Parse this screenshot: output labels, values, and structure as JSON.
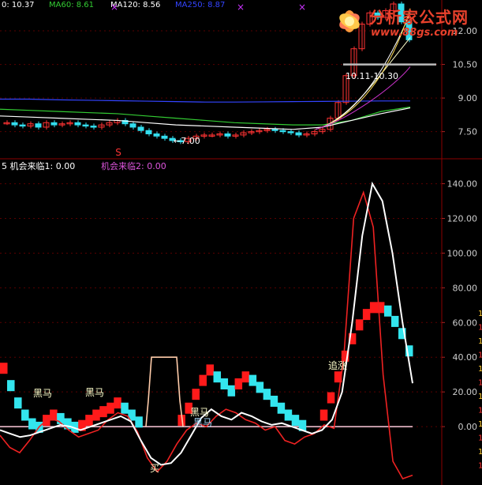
{
  "top_header": {
    "items": [
      {
        "text": "0: 10.37",
        "color": "#ffffff"
      },
      {
        "text": "MA60: 8.61",
        "color": "#33cc33"
      },
      {
        "text": "MA120: 8.56",
        "color": "#ffffff"
      },
      {
        "text": "MA250: 8.87",
        "color": "#3344ff"
      }
    ]
  },
  "bottom_header": {
    "items": [
      {
        "text": "5 机会来临1: 0.00",
        "color": "#ffffff"
      },
      {
        "text": "机会来临2: 0.00",
        "color": "#dd55dd"
      }
    ]
  },
  "watermark": {
    "title": "分析家公式网",
    "url": "www.88gs.com"
  },
  "annotations": {
    "range_label": "10.11-10.30",
    "low_label": "←7.00",
    "sell_marker": "S",
    "black_horse_1": "黑马",
    "black_horse_2": "黑马",
    "black_horse_3": "黑马",
    "black_horse_4": "黑马",
    "chase_label": "追涨",
    "buy_marker": "买"
  },
  "chart_data": [
    {
      "type": "line",
      "title": "",
      "ylim": [
        6.5,
        13.2
      ],
      "y_ticks": [
        "12.00",
        "10.50",
        "9.00",
        "7.50"
      ],
      "candles_close": [
        7.9,
        7.8,
        7.75,
        7.85,
        7.7,
        7.9,
        7.8,
        7.85,
        7.9,
        7.8,
        7.75,
        7.7,
        7.8,
        7.9,
        8.0,
        7.85,
        7.7,
        7.55,
        7.4,
        7.3,
        7.2,
        7.1,
        7.05,
        7.2,
        7.3,
        7.35,
        7.35,
        7.4,
        7.3,
        7.35,
        7.45,
        7.5,
        7.55,
        7.6,
        7.55,
        7.5,
        7.45,
        7.35,
        7.4,
        7.5,
        7.6,
        8.1,
        8.8,
        10.0,
        11.2,
        12.3,
        12.8,
        12.6,
        12.9,
        13.2,
        12.4,
        11.6
      ],
      "series": [
        {
          "name": "MA60",
          "color": "#33cc33",
          "values": [
            8.5,
            8.45,
            8.4,
            8.35,
            8.3,
            8.2,
            8.1,
            8.0,
            7.9,
            7.85,
            7.8,
            7.8,
            8.0,
            8.4,
            8.6
          ]
        },
        {
          "name": "MA120",
          "color": "#ffffff",
          "values": [
            8.2,
            8.15,
            8.1,
            8.05,
            8.0,
            7.9,
            7.8,
            7.75,
            7.7,
            7.65,
            7.6,
            7.7,
            8.0,
            8.3,
            8.56
          ]
        },
        {
          "name": "MA250",
          "color": "#3344ff",
          "values": [
            8.95,
            8.95,
            8.92,
            8.9,
            8.88,
            8.86,
            8.84,
            8.82,
            8.82,
            8.83,
            8.84,
            8.85,
            8.86,
            8.87,
            8.87
          ]
        }
      ],
      "reference_line": 10.5
    },
    {
      "type": "line",
      "title": "",
      "ylim": [
        -30,
        148
      ],
      "y_ticks": [
        "140.00",
        "120.00",
        "100.00",
        "80.00",
        "60.00",
        "40.00",
        "20.00",
        "0.00"
      ],
      "series": [
        {
          "name": "",
          "color": "#ee2222",
          "values": [
            -5,
            -12,
            -15,
            -8,
            0,
            5,
            3,
            -2,
            -6,
            -4,
            -2,
            4,
            8,
            6,
            -3,
            -18,
            -26,
            -20,
            -10,
            -2,
            2,
            0,
            6,
            10,
            8,
            4,
            2,
            -2,
            0,
            -8,
            -10,
            -6,
            -4,
            1,
            -1,
            40,
            120,
            135,
            115,
            30,
            -20,
            -30,
            -28
          ]
        },
        {
          "name": "",
          "color": "#ffffff",
          "values": [
            -2,
            -4,
            -6,
            -5,
            -3,
            -1,
            1,
            0,
            -2,
            0,
            2,
            4,
            6,
            3,
            -8,
            -18,
            -22,
            -21,
            -15,
            -5,
            5,
            10,
            6,
            4,
            8,
            6,
            3,
            1,
            2,
            0,
            -2,
            -4,
            -2,
            4,
            20,
            60,
            110,
            140,
            130,
            100,
            60,
            25
          ]
        },
        {
          "name": "",
          "color": "#ffccaa",
          "values": [
            0,
            0,
            0,
            0,
            0,
            0,
            0,
            0,
            0,
            0,
            0,
            40,
            40,
            40,
            0,
            0,
            0,
            0,
            0,
            0
          ]
        }
      ],
      "bars": [
        35,
        25,
        15,
        8,
        3,
        1,
        5,
        8,
        6,
        3,
        1,
        2,
        5,
        8,
        10,
        12,
        15,
        12,
        8,
        4,
        0,
        0,
        0,
        0,
        0,
        5,
        12,
        20,
        28,
        34,
        30,
        26,
        22,
        26,
        30,
        28,
        24,
        20,
        16,
        12,
        8,
        5,
        2,
        0,
        0,
        8,
        18,
        30,
        42,
        52,
        60,
        66,
        70,
        70,
        68,
        62,
        55,
        45
      ]
    }
  ]
}
